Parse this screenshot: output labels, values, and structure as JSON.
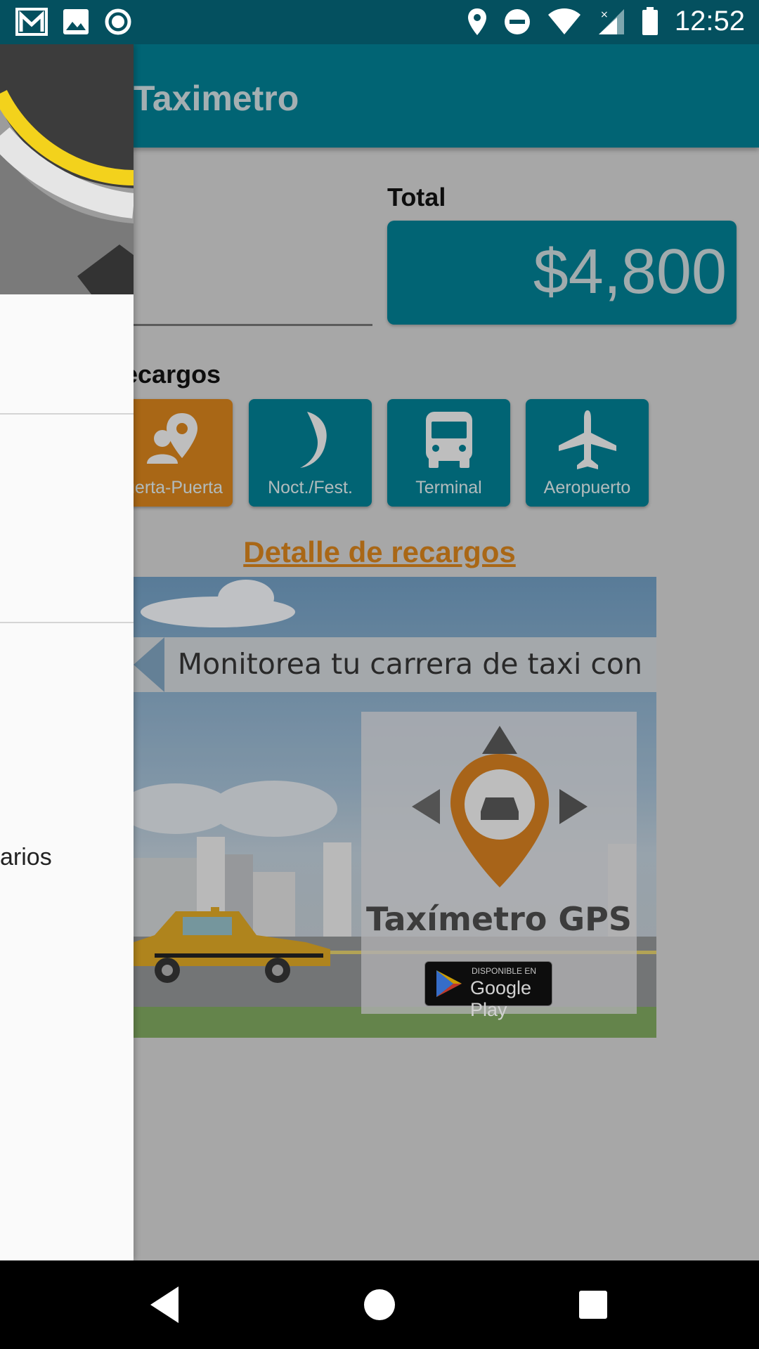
{
  "status_bar": {
    "time": "12:52",
    "left_icons": [
      "gmail-icon",
      "image-icon",
      "record-icon"
    ],
    "right_icons": [
      "location-icon",
      "do-not-disturb-icon",
      "wifi-icon",
      "signal-icon",
      "battery-icon"
    ]
  },
  "app_bar": {
    "title": "Taximetro"
  },
  "fare": {
    "total_label": "Total",
    "total_value": "$4,800"
  },
  "surcharges": {
    "title": "ecargos",
    "items": [
      {
        "label": "uerta-Puerta",
        "icon": "door-to-door-icon",
        "active": true
      },
      {
        "label": "Nocturno/Festivo",
        "display": "Nocturno/Festivo",
        "icon": "moon-icon",
        "active": false
      },
      {
        "label": "Terminal",
        "icon": "bus-icon",
        "active": false
      },
      {
        "label": "Aeropuerto",
        "icon": "airplane-icon",
        "active": false
      }
    ],
    "detail_link": "Detalle de recargos"
  },
  "banner": {
    "headline": "Monitorea tu carrera de taxi con",
    "brand": "Taxímetro GPS",
    "store_small": "DISPONIBLE EN",
    "store_big": "Google Play"
  },
  "drawer": {
    "partial_item": "arios"
  },
  "colors": {
    "status_bar": "#04505f",
    "primary": "#027a8e",
    "accent": "#cf7e1c",
    "background": "#cccccc"
  }
}
